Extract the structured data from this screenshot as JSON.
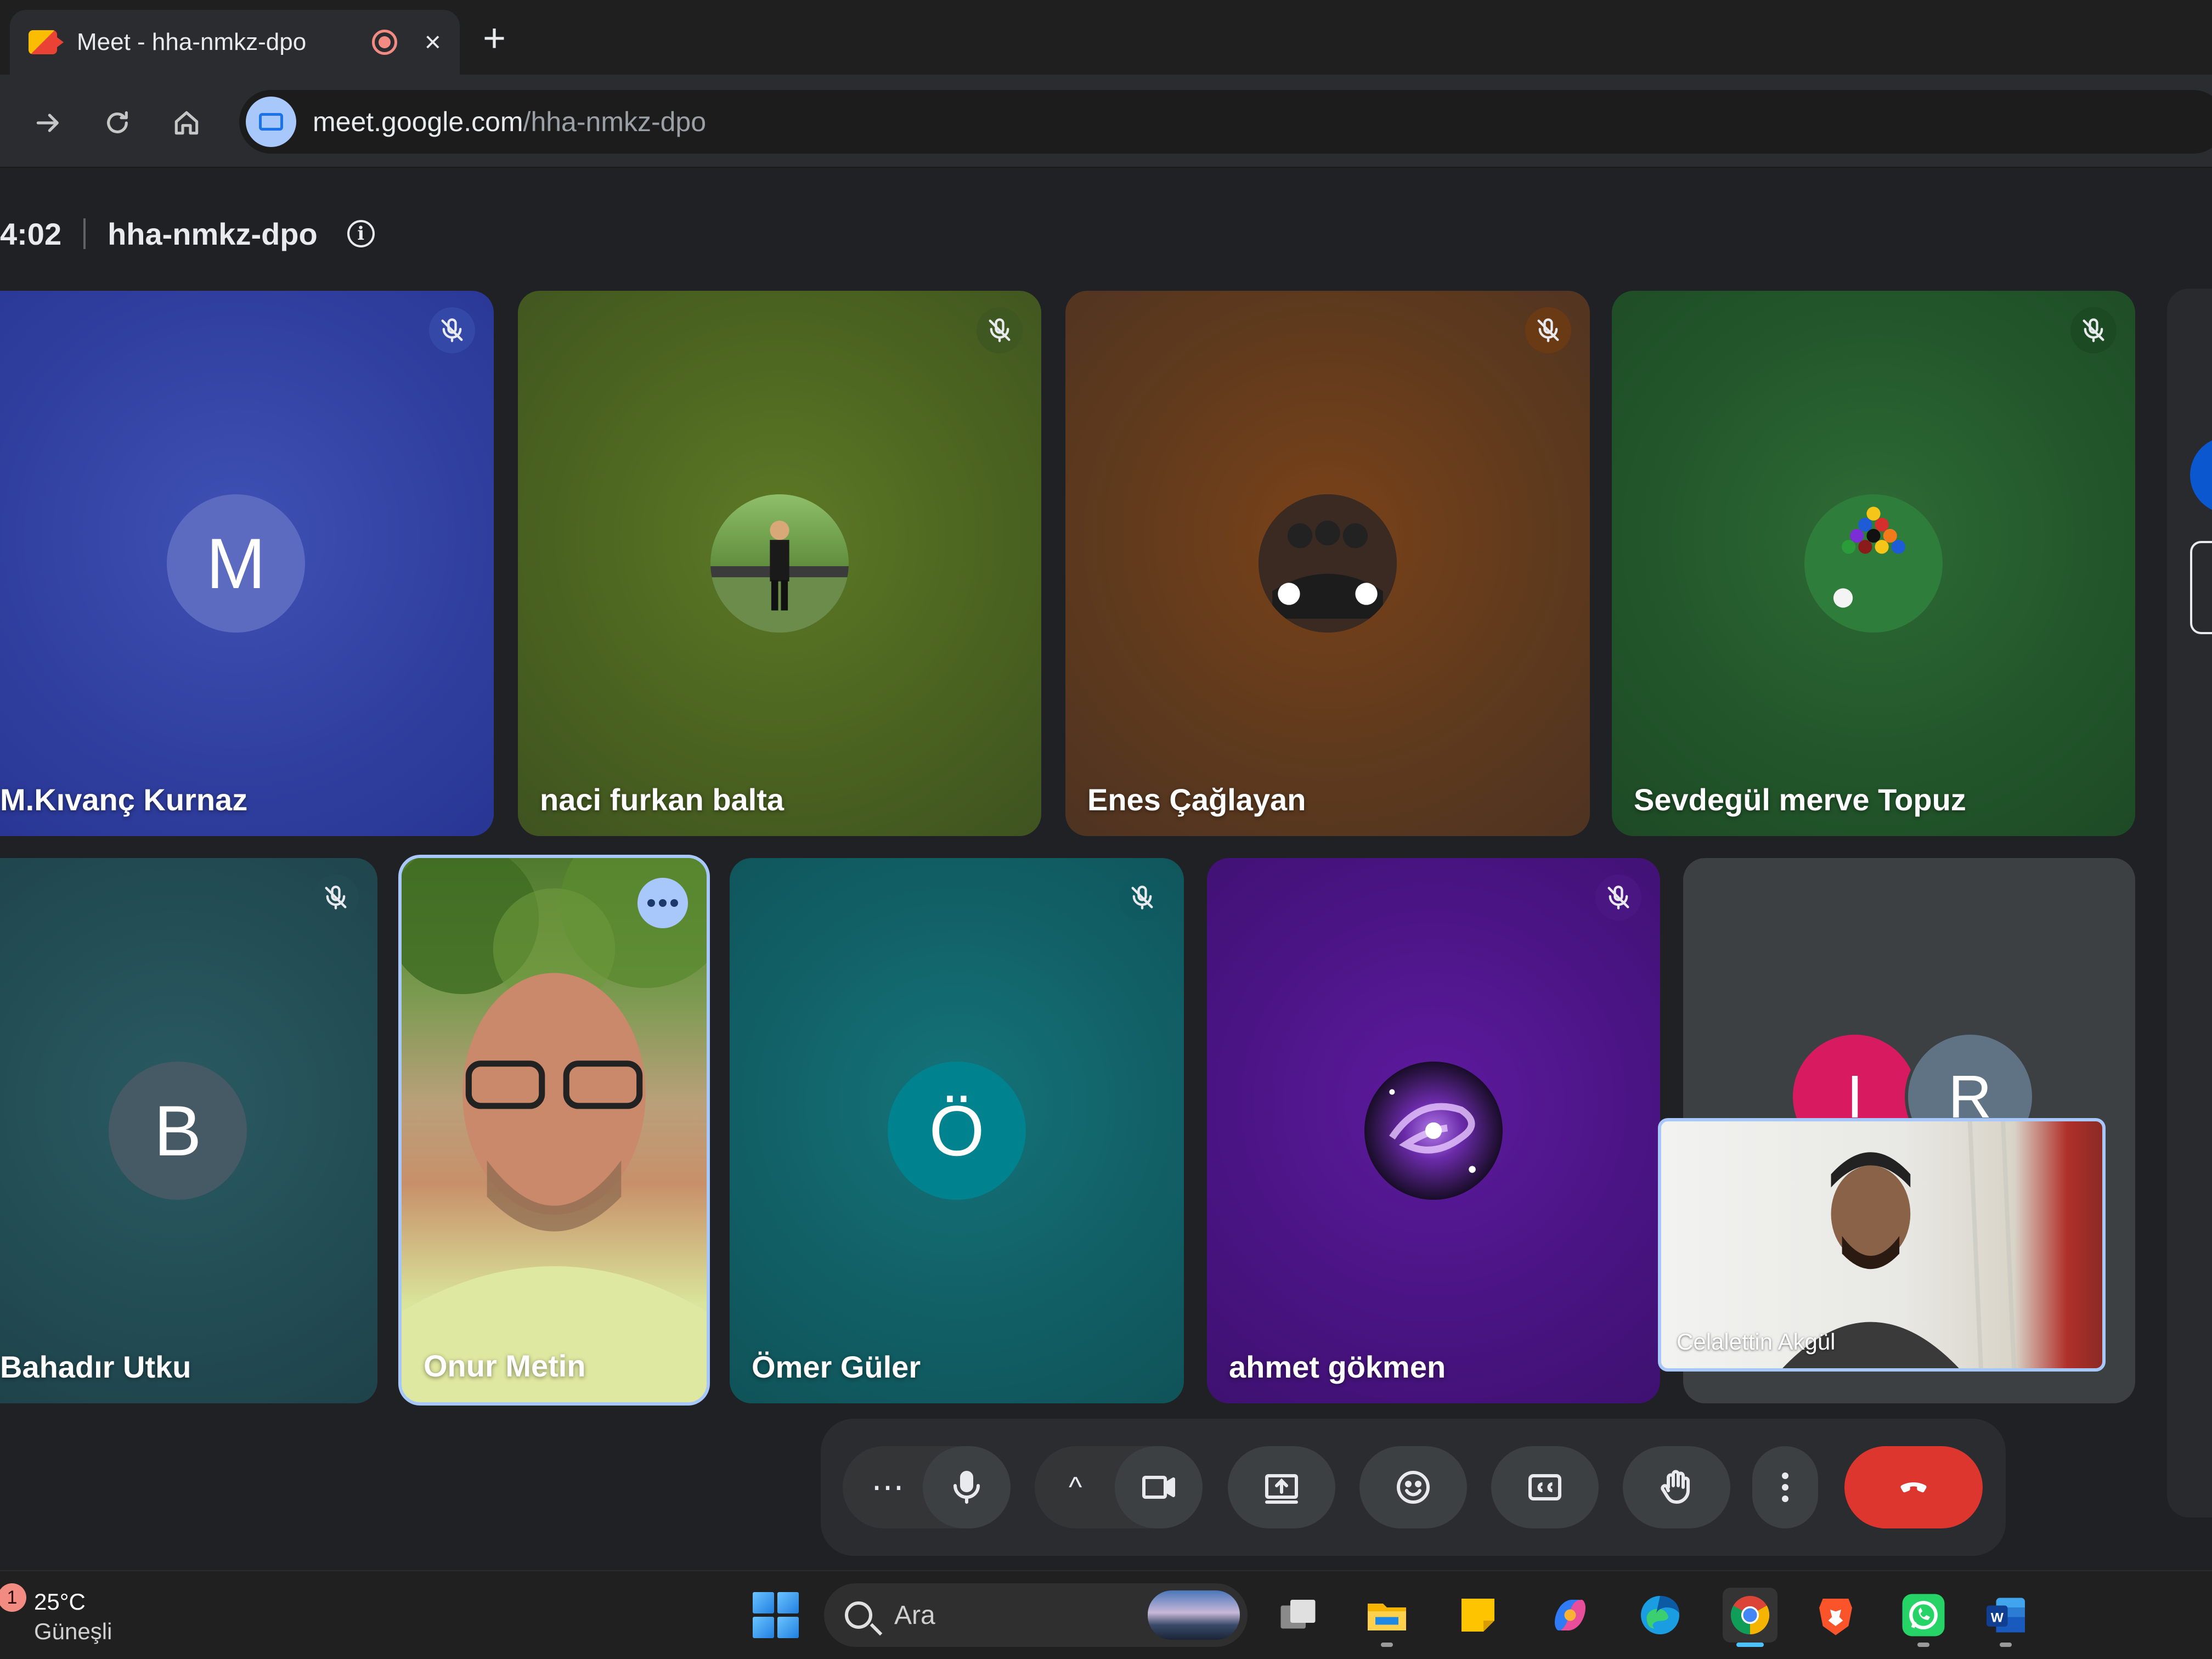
{
  "browser": {
    "tab_title": "Meet - hha-nmkz-dpo",
    "new_tab_symbol": "+",
    "close_symbol": "×",
    "url_host": "meet.google.com",
    "url_path": "/hha-nmkz-dpo"
  },
  "meeting": {
    "time": "4:02",
    "code": "hha-nmkz-dpo",
    "info_symbol": "i"
  },
  "participants": [
    {
      "name": "M.Kıvanç Kurnaz",
      "initial": "M",
      "muted": true,
      "bg": "#3949ab",
      "avatar_color": "#5c6bc0"
    },
    {
      "name": "naci furkan balta",
      "initial": "",
      "muted": true,
      "bg": "#556b1f",
      "avatar_color": "#4f6b2c"
    },
    {
      "name": "Enes Çağlayan",
      "initial": "",
      "muted": true,
      "bg": "#6d3e1f",
      "avatar_color": "#444444"
    },
    {
      "name": "Sevdegül merve Topuz",
      "initial": "",
      "muted": true,
      "bg": "#1f5e2d",
      "avatar_color": "#2f7d3a"
    },
    {
      "name": "Bahadır Utku",
      "initial": "B",
      "muted": true,
      "bg": "#24535c",
      "avatar_color": "#455a64"
    },
    {
      "name": "Onur Metin",
      "initial": "",
      "muted": false,
      "bg": "#6b8f45",
      "avatar_color": "#e0c090",
      "video": true
    },
    {
      "name": "Ömer Güler",
      "initial": "Ö",
      "muted": true,
      "bg": "#136d72",
      "avatar_color": "#00838f"
    },
    {
      "name": "ahmet gökmen",
      "initial": "",
      "muted": true,
      "bg": "#4a148c",
      "avatar_color": "#2a1040"
    }
  ],
  "others_tile": {
    "initials": [
      "I",
      "R"
    ],
    "colors": [
      "#d81b60",
      "#5f7384"
    ]
  },
  "self_view": {
    "name": "Celalettin Akgül"
  },
  "controls": {
    "more_options_symbol": "⋯",
    "caret_symbol": "^"
  },
  "taskbar": {
    "notification_count": "1",
    "temperature": "25°C",
    "weather": "Güneşli",
    "search_placeholder": "Ara"
  }
}
